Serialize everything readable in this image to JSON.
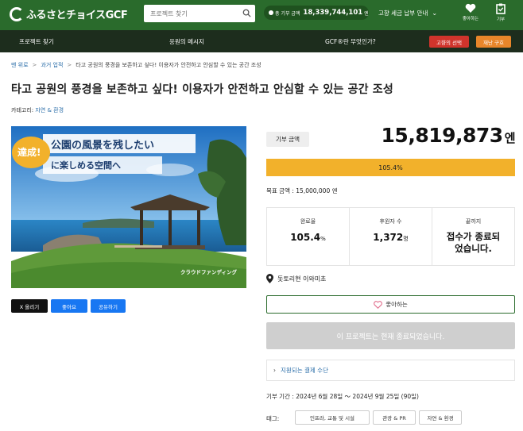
{
  "header": {
    "logo_text": "ふるさとチョイスGCF",
    "search_placeholder": "프로젝트 찾기",
    "total_label": "총 기부 금액",
    "total_value": "18,339,744,101",
    "total_unit": "엔",
    "guide_label": "고향 세금 납부 안내",
    "like_label": "좋아하는",
    "donate_label": "기부"
  },
  "nav": {
    "items": [
      "프로젝트 찾기",
      "응원의 메시지",
      "GCF®란 무엇인가?"
    ],
    "choice_button": "고향의 선택",
    "disaster_button": "재난 구호"
  },
  "breadcrumb": [
    "맨 위로",
    "과거 업적",
    "타고 공원의 풍경을 보존하고 싶다! 이용자가 안전하고 안심할 수 있는 공간 조성"
  ],
  "project": {
    "title": "타고 공원의 풍경을 보존하고 싶다! 이용자가 안전하고 안심할 수 있는 공간 조성",
    "category_label": "카테고리:",
    "category_value": "자연 & 환경",
    "hero": {
      "badge": "達成!",
      "line1": "公園の風景を残したい",
      "line2": "に楽しめる空間へ",
      "watermark": "クラウドファンディング"
    }
  },
  "share": {
    "x": "X 올리기",
    "like": "좋아요",
    "share": "공유하기"
  },
  "funding": {
    "amount_label": "기부 금액",
    "amount": "15,819,873",
    "amount_unit": "엔",
    "progress_percent": 105.4,
    "progress_text": "105.4%",
    "goal_text": "목표 금액 : 15,000,000 엔",
    "stats": {
      "rate_label": "완료율",
      "rate_value": "105.4",
      "rate_unit": "%",
      "supporters_label": "후원자 수",
      "supporters_value": "1,372",
      "supporters_unit": "명",
      "until_label": "끝까지",
      "until_line1": "접수가 종료되",
      "until_line2": "었습니다."
    },
    "location": "돗토리현 이와미초",
    "like_button": "좋아하는",
    "closed_button": "이 프로젝트는 현재 종료되었습니다.",
    "payment_link": "지원되는 결제 수단",
    "period": "기부 기간 : 2024년 6월 28일 ～ 2024년 9월 25일 (90일)",
    "tags_label": "태그:",
    "tags": [
      "인프라, 교통 및 시설",
      "관광 & PR",
      "자연 & 환경"
    ]
  },
  "colors": {
    "header_green": "#2a6b2c",
    "nav_dark": "#1d2d1d",
    "progress_yellow": "#f2b12b",
    "link_blue": "#2a6da8",
    "choice_red": "#d0342c",
    "disaster_orange": "#e8862a"
  }
}
